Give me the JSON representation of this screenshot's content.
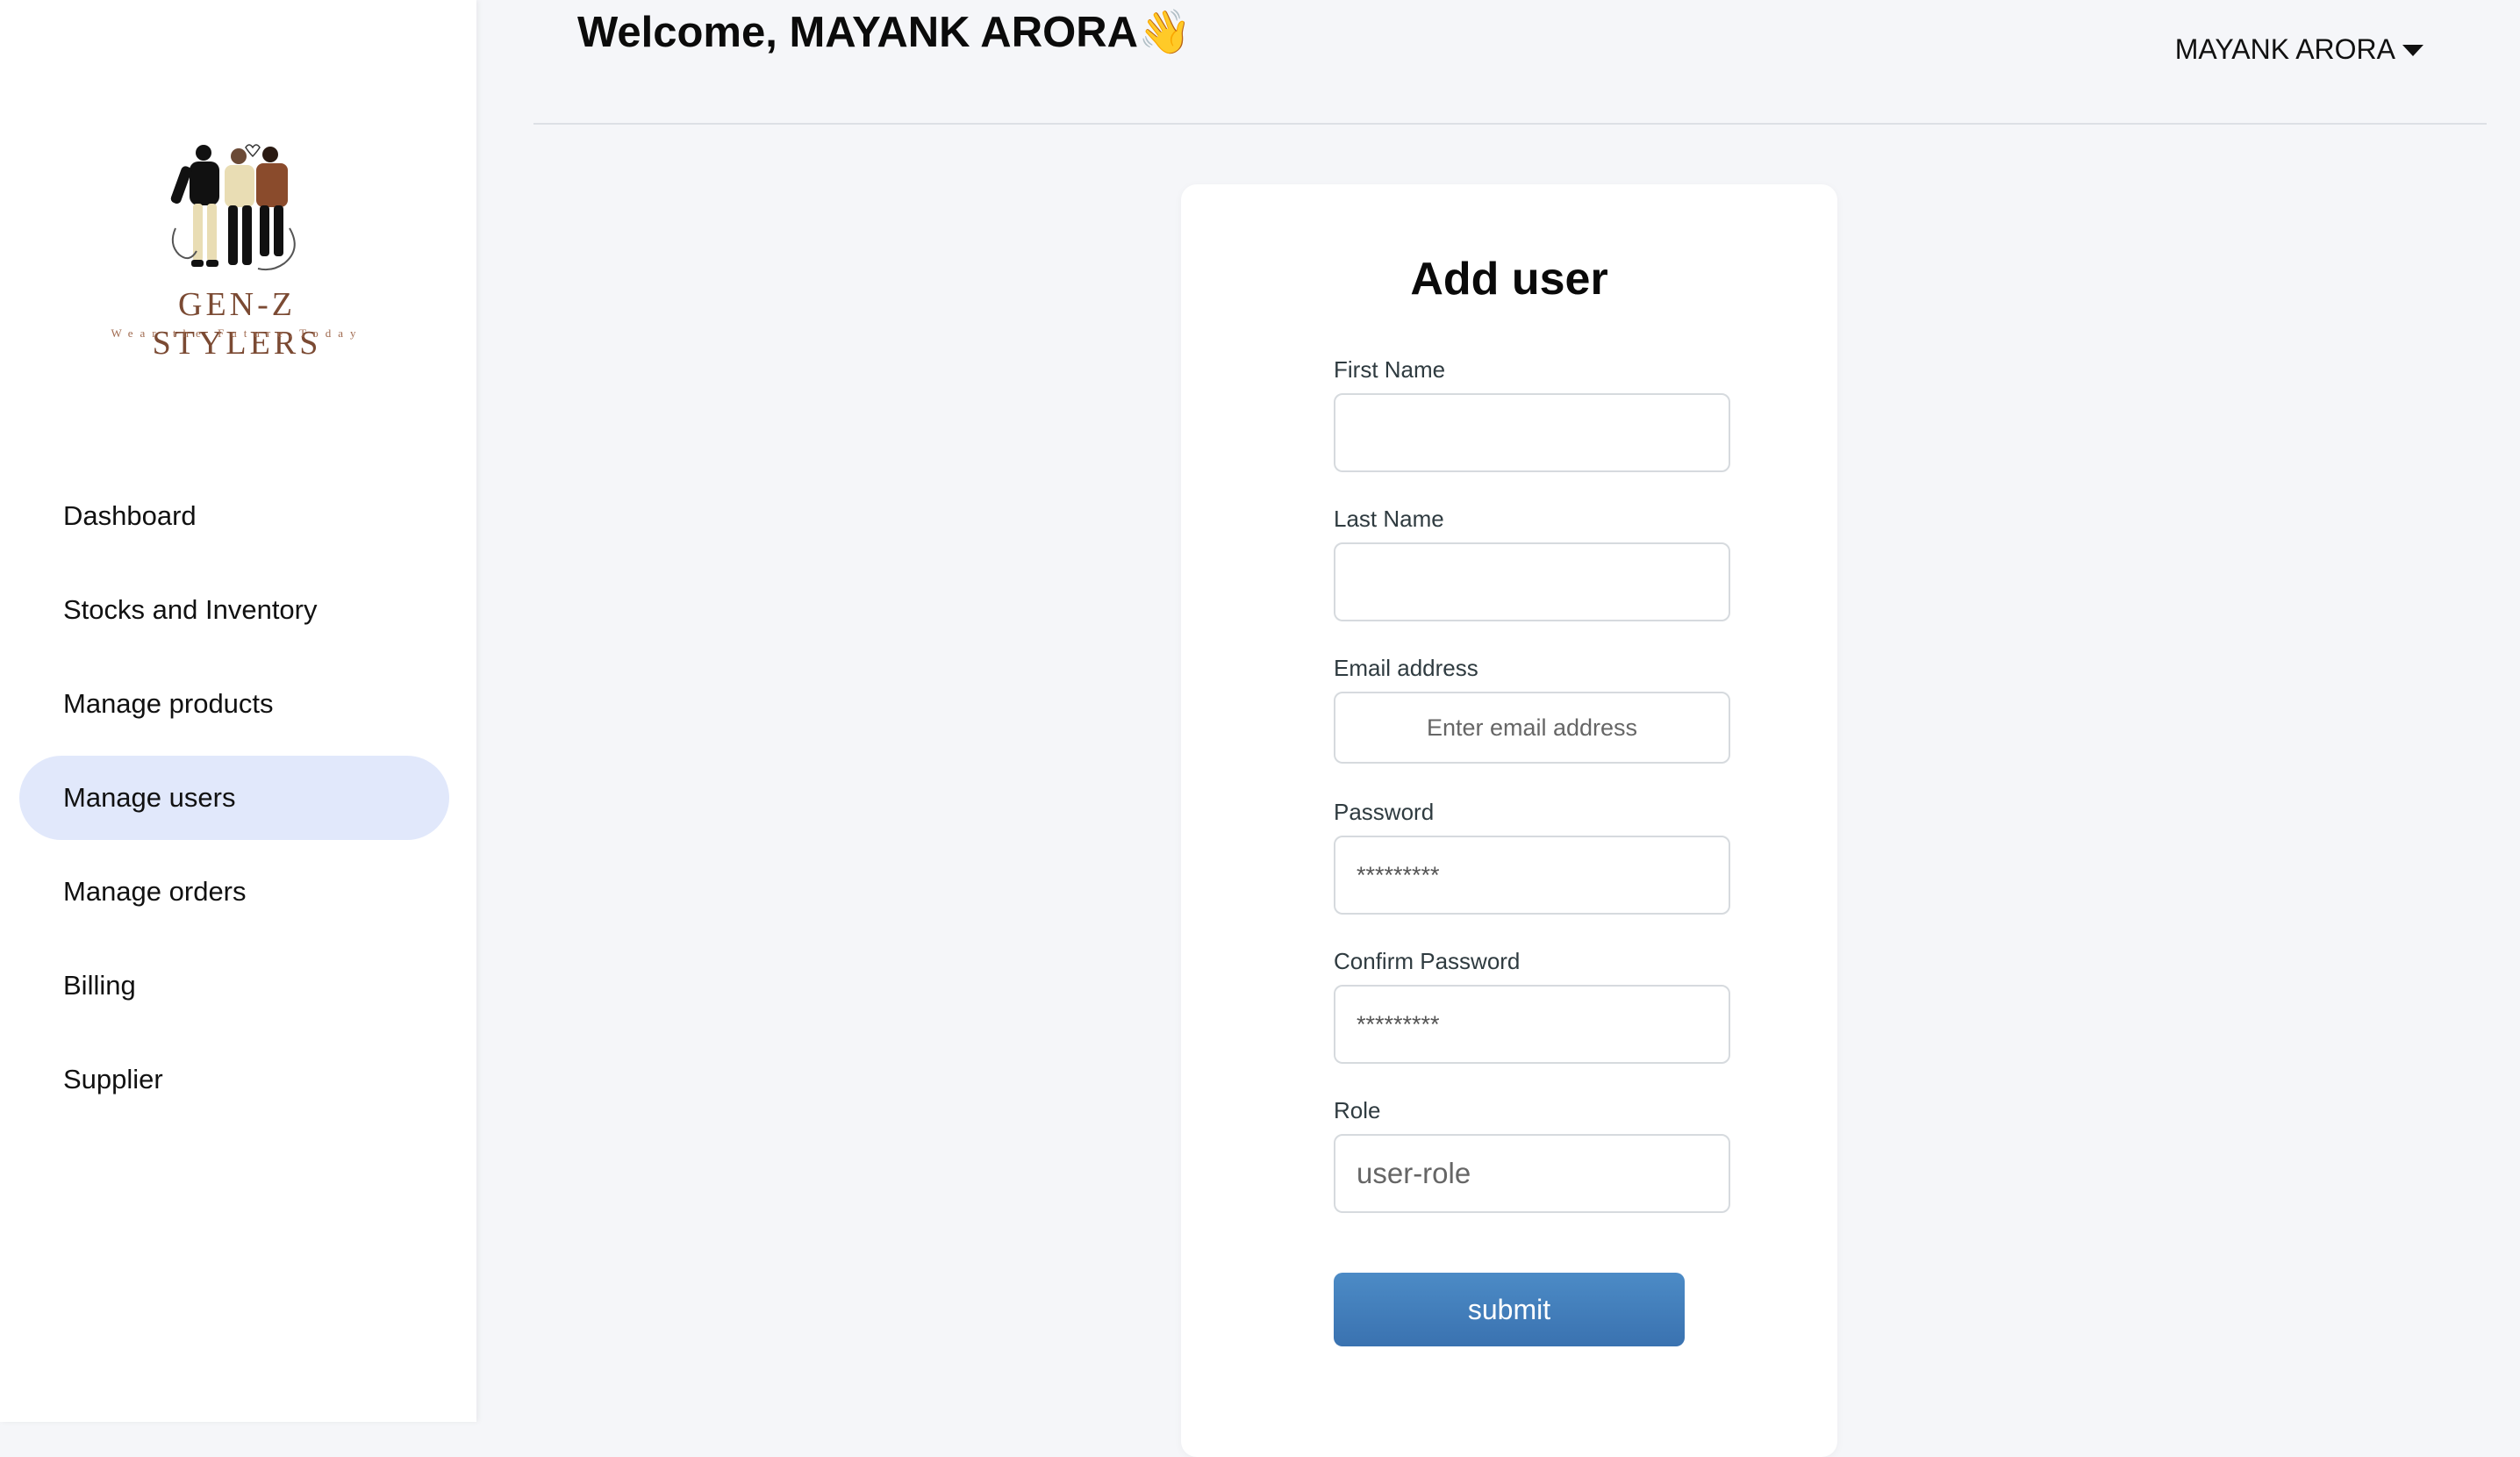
{
  "brand": {
    "name": "GEN-Z STYLERS",
    "tagline": "Wear the Future,Today"
  },
  "sidebar": {
    "items": [
      {
        "label": "Dashboard",
        "active": false
      },
      {
        "label": "Stocks and Inventory",
        "active": false
      },
      {
        "label": "Manage products",
        "active": false
      },
      {
        "label": "Manage users",
        "active": true
      },
      {
        "label": "Manage orders",
        "active": false
      },
      {
        "label": "Billing",
        "active": false
      },
      {
        "label": "Supplier",
        "active": false
      }
    ]
  },
  "header": {
    "welcome": "Welcome, MAYANK ARORA👋",
    "user_menu_label": "MAYANK ARORA",
    "user_menu_icon": "caret-down-icon"
  },
  "form": {
    "title": "Add user",
    "fields": {
      "first_name": {
        "label": "First Name",
        "value": ""
      },
      "last_name": {
        "label": "Last Name",
        "value": ""
      },
      "email": {
        "label": "Email address",
        "placeholder": "Enter email address"
      },
      "password": {
        "label": "Password",
        "value": "*********"
      },
      "confirm_password": {
        "label": "Confirm Password",
        "value": "*********"
      },
      "role": {
        "label": "Role",
        "placeholder": "user-role"
      }
    },
    "submit_label": "submit"
  },
  "colors": {
    "active_nav_bg": "#e1e8fb",
    "button": "#3f7bbb",
    "brand": "#7b4a33"
  }
}
